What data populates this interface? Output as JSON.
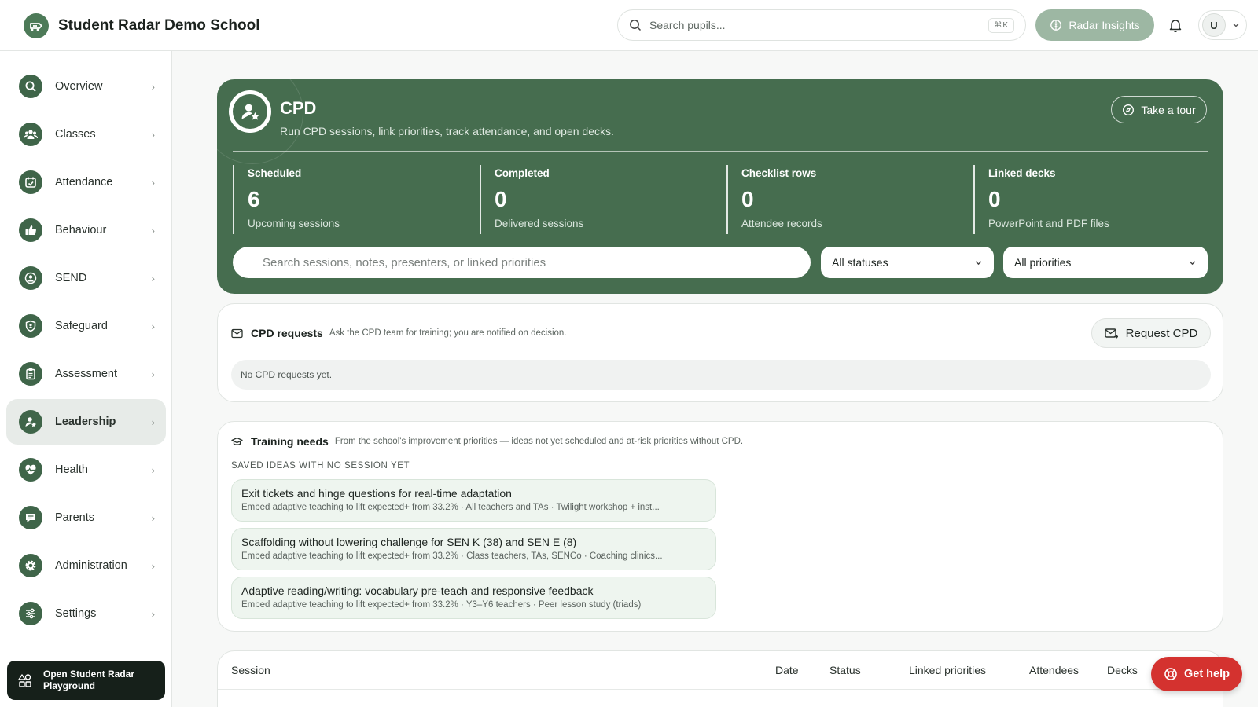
{
  "header": {
    "school_name": "Student Radar Demo School",
    "search_placeholder": "Search pupils...",
    "search_shortcut": "⌘K",
    "insights_label": "Radar Insights",
    "avatar_initial": "U"
  },
  "sidebar": {
    "items": [
      {
        "label": "Overview",
        "icon": "search-icon"
      },
      {
        "label": "Classes",
        "icon": "group-icon"
      },
      {
        "label": "Attendance",
        "icon": "calendar-check-icon"
      },
      {
        "label": "Behaviour",
        "icon": "thumbs-up-icon"
      },
      {
        "label": "SEND",
        "icon": "person-circle-icon"
      },
      {
        "label": "Safeguard",
        "icon": "shield-icon"
      },
      {
        "label": "Assessment",
        "icon": "clipboard-icon"
      },
      {
        "label": "Leadership",
        "icon": "user-star-icon",
        "active": true
      },
      {
        "label": "Health",
        "icon": "heart-pulse-icon"
      },
      {
        "label": "Parents",
        "icon": "chat-icon"
      },
      {
        "label": "Administration",
        "icon": "gear-icon"
      },
      {
        "label": "Settings",
        "icon": "sliders-icon"
      }
    ],
    "playground_label": "Open Student Radar Playground"
  },
  "hero": {
    "title": "CPD",
    "subtitle": "Run CPD sessions, link priorities, track attendance, and open decks.",
    "tour_label": "Take a tour",
    "stats": [
      {
        "label": "Scheduled",
        "value": "6",
        "desc": "Upcoming sessions"
      },
      {
        "label": "Completed",
        "value": "0",
        "desc": "Delivered sessions"
      },
      {
        "label": "Checklist rows",
        "value": "0",
        "desc": "Attendee records"
      },
      {
        "label": "Linked decks",
        "value": "0",
        "desc": "PowerPoint and PDF files"
      }
    ],
    "search_placeholder": "Search sessions, notes, presenters, or linked priorities",
    "status_filter": "All statuses",
    "priority_filter": "All priorities"
  },
  "requests": {
    "title": "CPD requests",
    "hint": "Ask the CPD team for training; you are notified on decision.",
    "button_label": "Request CPD",
    "empty_text": "No CPD requests yet."
  },
  "training": {
    "title": "Training needs",
    "hint": "From the school's improvement priorities — ideas not yet scheduled and at-risk priorities without CPD.",
    "section_label": "SAVED IDEAS WITH NO SESSION YET",
    "ideas": [
      {
        "title": "Exit tickets and hinge questions for real-time adaptation",
        "sub": "Embed adaptive teaching to lift expected+ from 33.2% · All teachers and TAs · Twilight workshop + inst..."
      },
      {
        "title": "Scaffolding without lowering challenge for SEN K (38) and SEN E (8)",
        "sub": "Embed adaptive teaching to lift expected+ from 33.2% · Class teachers, TAs, SENCo · Coaching clinics..."
      },
      {
        "title": "Adaptive reading/writing: vocabulary pre-teach and responsive feedback",
        "sub": "Embed adaptive teaching to lift expected+ from 33.2% · Y3–Y6 teachers · Peer lesson study (triads)"
      }
    ]
  },
  "table": {
    "columns": [
      "Session",
      "Date",
      "Status",
      "Linked priorities",
      "Attendees",
      "Decks"
    ]
  },
  "help_label": "Get help",
  "colors": {
    "brand": "#466d4f",
    "help": "#d4322f"
  }
}
